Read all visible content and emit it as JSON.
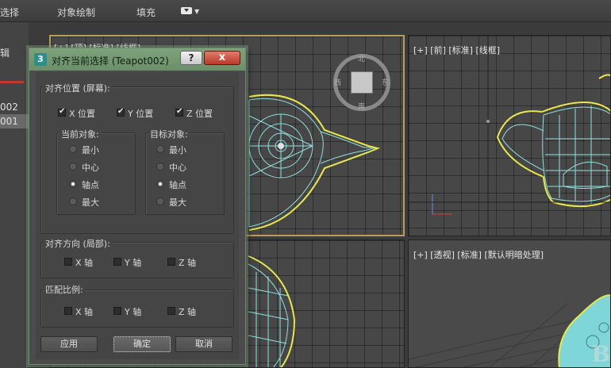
{
  "menubar": {
    "items": [
      "选择",
      "对象绘制",
      "填充"
    ]
  },
  "explorer": {
    "header": "辑",
    "rows": [
      "002",
      "001"
    ]
  },
  "viewports": {
    "top": "[+] [顶] [标准] [线框]",
    "front": "[+] [前] [标准] [线框]",
    "persp": "[+] [透视] [标准] [默认明暗处理]"
  },
  "viewcube": {
    "n": "北",
    "w": "西",
    "e": "东",
    "s": "南"
  },
  "dialog": {
    "icon": "3",
    "title": "对齐当前选择 (Teapot002)",
    "help": "?",
    "close": "x",
    "align_position": {
      "label": "对齐位置 (屏幕):",
      "x": "X 位置",
      "y": "Y 位置",
      "z": "Z 位置"
    },
    "current_object": {
      "label": "当前对象:",
      "options": [
        "最小",
        "中心",
        "轴点",
        "最大"
      ],
      "selected": "轴点"
    },
    "target_object": {
      "label": "目标对象:",
      "options": [
        "最小",
        "中心",
        "轴点",
        "最大"
      ],
      "selected": "轴点"
    },
    "align_orientation": {
      "label": "对齐方向 (局部):",
      "x": "X 轴",
      "y": "Y 轴",
      "z": "Z 轴"
    },
    "match_scale": {
      "label": "匹配比例:",
      "x": "X 轴",
      "y": "Y 轴",
      "z": "Z 轴"
    },
    "buttons": {
      "apply": "应用",
      "ok": "确定",
      "cancel": "取消"
    }
  },
  "colors": {
    "selection_outline": "#e8e84a",
    "wire": "#8fe0e0",
    "titlebar": "#7ea37c"
  }
}
